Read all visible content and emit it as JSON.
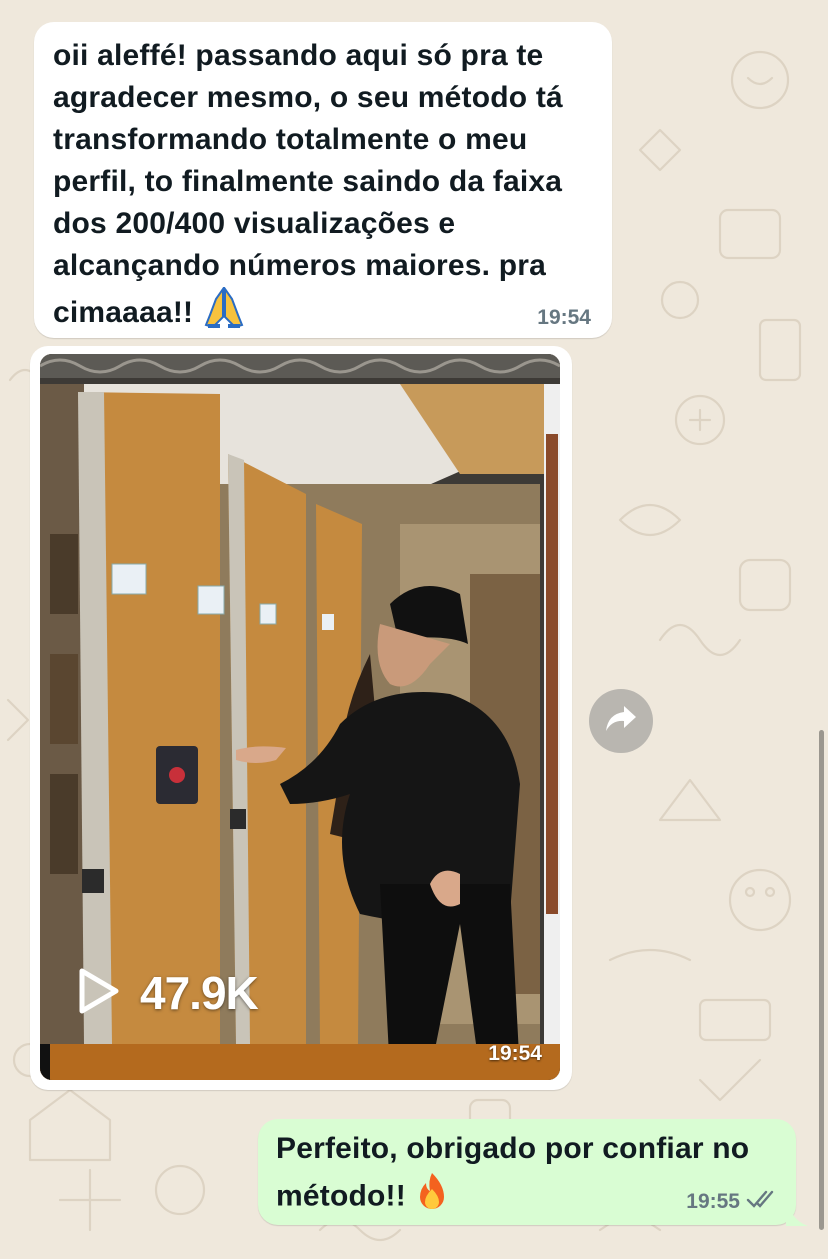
{
  "chat": {
    "messages": [
      {
        "direction": "incoming",
        "text": "oii aleffé! passando aqui só pra te\nagradecer mesmo, o seu método tá\ntransformando totalmente o meu\nperfil, to finalmente saindo da faixa\ndos 200/400 visualizações e\nalcançando números maiores. pra\ncimaaaa!!",
        "emoji": "folded-hands",
        "time": "19:54"
      },
      {
        "direction": "incoming",
        "type": "image",
        "views_count": "47.9K",
        "time": "19:54"
      },
      {
        "direction": "outgoing",
        "text": "Perfeito, obrigado por confiar no\nmétodo!!",
        "emoji": "fire",
        "time": "19:55",
        "status_icon": "double-check-icon"
      }
    ]
  },
  "colors": {
    "incoming_bubble": "#ffffff",
    "outgoing_bubble": "#d9fdd3",
    "wallpaper": "#efe8dc",
    "timestamp": "#667781"
  }
}
